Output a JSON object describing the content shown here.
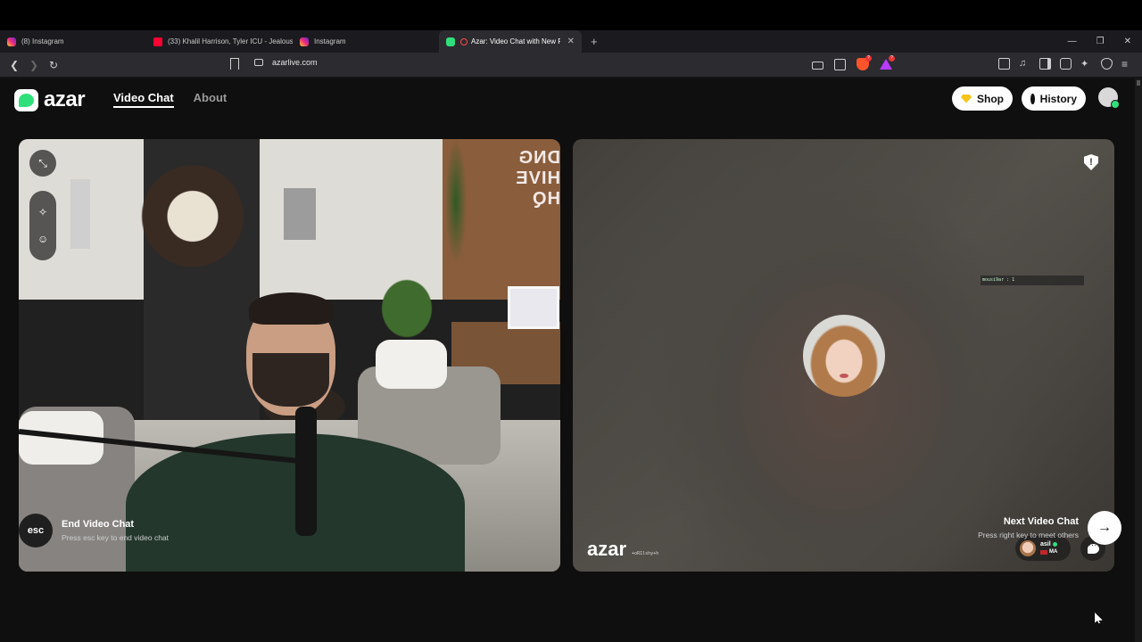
{
  "browser": {
    "tabs": [
      {
        "title": "(8) Instagram",
        "icon": "instagram-icon",
        "active": false
      },
      {
        "title": "(33) Khalil Harrison, Tyler ICU - Jealous",
        "icon": "youtube-icon",
        "active": false
      },
      {
        "title": "Instagram",
        "icon": "instagram-icon",
        "active": false
      },
      {
        "title": "Azar: Video Chat with New People",
        "icon": "azar-icon",
        "active": true
      }
    ],
    "new_tab": "+",
    "window_controls": {
      "minimize": "—",
      "restore": "❐",
      "close": "✕"
    },
    "url": "azarlive.com",
    "brave_badge": "?",
    "rewards_badge": "?"
  },
  "site": {
    "logo_text": "azar",
    "nav": [
      {
        "label": "Video Chat",
        "active": true
      },
      {
        "label": "About",
        "active": false
      }
    ],
    "shop_label": "Shop",
    "history_label": "History"
  },
  "left_pane": {
    "neon_sign": "DNG HIVE HQ"
  },
  "right_pane": {
    "overlay_text": "mousi9ar : 1",
    "watermark": "azar",
    "watermark_id": "+oR1lshy+h",
    "partner": {
      "name": "asil",
      "country": "MA"
    }
  },
  "footer": {
    "esc_label": "esc",
    "end_title": "End Video Chat",
    "end_hint": "Press esc key to end video chat",
    "next_title": "Next Video Chat",
    "next_hint": "Press right key to meet others",
    "next_icon": "→"
  },
  "colors": {
    "brand_green": "#2fe07a",
    "background": "#0f0f0f"
  }
}
